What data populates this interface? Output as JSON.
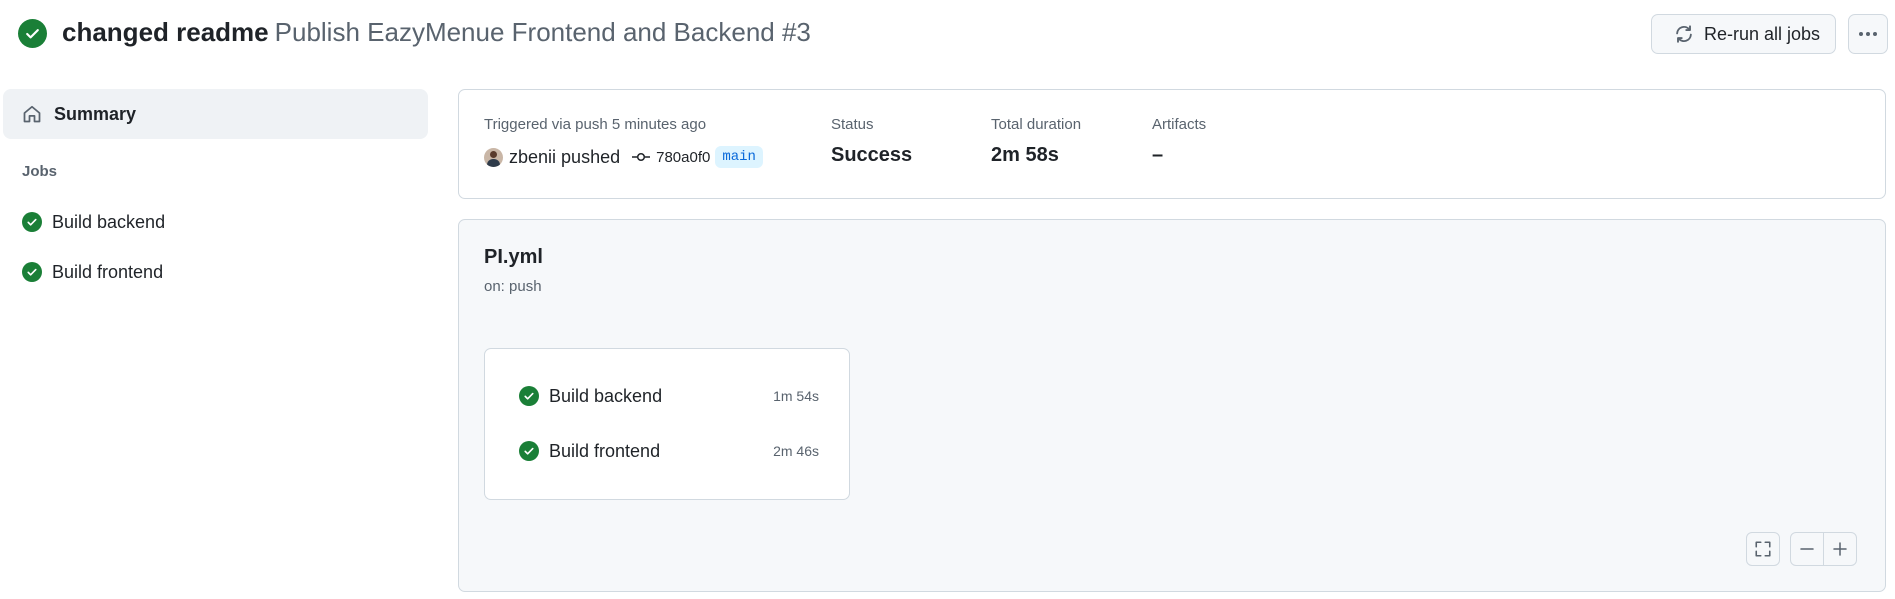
{
  "header": {
    "commit_title": "changed readme",
    "workflow_run": "Publish EazyMenue Frontend and Backend #3",
    "rerun_label": "Re-run all jobs",
    "more_icon": "kebab-horizontal-icon"
  },
  "sidebar": {
    "summary_label": "Summary",
    "jobs_heading": "Jobs",
    "jobs": [
      {
        "label": "Build backend",
        "status": "success"
      },
      {
        "label": "Build frontend",
        "status": "success"
      }
    ]
  },
  "summary": {
    "triggered_label": "Triggered via push 5 minutes ago",
    "actor": "zbenii",
    "action": "pushed",
    "commit_sha": "780a0f0",
    "branch": "main",
    "status_label": "Status",
    "status_value": "Success",
    "duration_label": "Total duration",
    "duration_value": "2m 58s",
    "artifacts_label": "Artifacts",
    "artifacts_value": "–"
  },
  "workflow": {
    "file_name": "PI.yml",
    "trigger": "on: push",
    "jobs": [
      {
        "label": "Build backend",
        "duration": "1m 54s"
      },
      {
        "label": "Build frontend",
        "duration": "2m 46s"
      }
    ]
  },
  "colors": {
    "success": "#1a7f37",
    "accent": "#0969da",
    "muted_text": "#59636e"
  }
}
